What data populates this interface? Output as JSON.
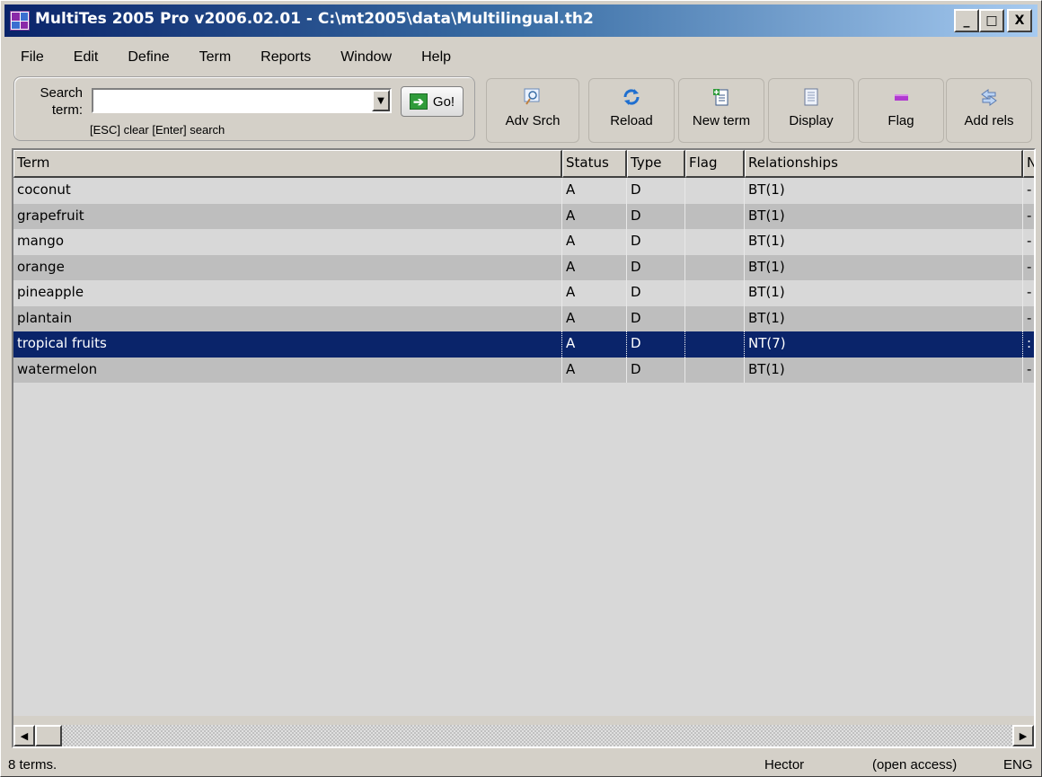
{
  "window": {
    "title": "MultiTes 2005 Pro v2006.02.01 - C:\\mt2005\\data\\Multilingual.th2",
    "min": "_",
    "max": "□",
    "close": "X"
  },
  "menu": [
    "File",
    "Edit",
    "Define",
    "Term",
    "Reports",
    "Window",
    "Help"
  ],
  "search": {
    "label_line1": "Search",
    "label_line2": "term:",
    "value": "",
    "placeholder": "",
    "hint": "[ESC] clear  [Enter] search",
    "go_label": "Go!"
  },
  "toolbar": {
    "adv_srch": "Adv Srch",
    "reload": "Reload",
    "new_term": "New term",
    "display": "Display",
    "flag": "Flag",
    "add_rels": "Add rels"
  },
  "grid": {
    "columns": [
      "Term",
      "Status",
      "Type",
      "Flag",
      "Relationships",
      "N"
    ],
    "rows": [
      {
        "term": "coconut",
        "status": "A",
        "type": "D",
        "flag": "",
        "rel": "BT(1)",
        "more": "-"
      },
      {
        "term": "grapefruit",
        "status": "A",
        "type": "D",
        "flag": "",
        "rel": "BT(1)",
        "more": "-"
      },
      {
        "term": "mango",
        "status": "A",
        "type": "D",
        "flag": "",
        "rel": "BT(1)",
        "more": "-"
      },
      {
        "term": "orange",
        "status": "A",
        "type": "D",
        "flag": "",
        "rel": "BT(1)",
        "more": "-"
      },
      {
        "term": "pineapple",
        "status": "A",
        "type": "D",
        "flag": "",
        "rel": "BT(1)",
        "more": "-"
      },
      {
        "term": "plantain",
        "status": "A",
        "type": "D",
        "flag": "",
        "rel": "BT(1)",
        "more": "-"
      },
      {
        "term": "tropical fruits",
        "status": "A",
        "type": "D",
        "flag": "",
        "rel": "NT(7)",
        "more": ":",
        "selected": true
      },
      {
        "term": "watermelon",
        "status": "A",
        "type": "D",
        "flag": "",
        "rel": "BT(1)",
        "more": "-"
      }
    ]
  },
  "status": {
    "count": "8 terms.",
    "user": "Hector",
    "access": "(open access)",
    "lang": "ENG"
  },
  "colors": {
    "selection": "#0a246a",
    "title_start": "#0a246a",
    "title_end": "#a6caf0"
  }
}
